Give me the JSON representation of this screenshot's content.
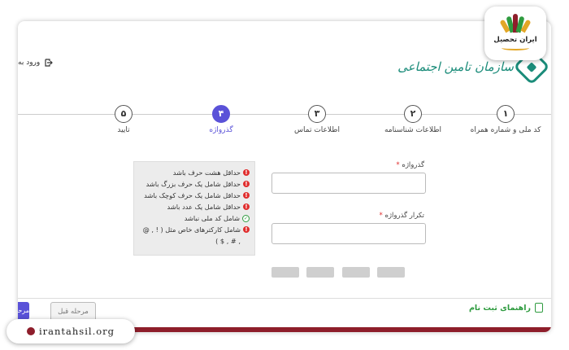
{
  "header": {
    "login_label": "ورود به",
    "logo_text": "سازمان تامین اجتماعی"
  },
  "steps": [
    {
      "number": "۱",
      "label": "کد ملی و شماره همراه"
    },
    {
      "number": "۲",
      "label": "اطلاعات شناسنامه"
    },
    {
      "number": "۳",
      "label": "اطلاعات تماس"
    },
    {
      "number": "۴",
      "label": "گذرواژه",
      "active": true
    },
    {
      "number": "۵",
      "label": "تایید"
    }
  ],
  "form": {
    "password_label": "گذرواژه",
    "password_required": "*",
    "password_value": "",
    "confirm_label": "تکرار گذرواژه",
    "confirm_required": "*",
    "confirm_value": ""
  },
  "rules": [
    {
      "text": "حداقل هشت حرف باشد",
      "status": "error"
    },
    {
      "text": "حداقل شامل یک حرف بزرگ باشد",
      "status": "error"
    },
    {
      "text": "حداقل شامل یک حرف کوچک باشد",
      "status": "error"
    },
    {
      "text": "حداقل شامل یک عدد باشد",
      "status": "error"
    },
    {
      "text": "شامل کد ملی نباشد",
      "status": "ok"
    },
    {
      "text": "شامل کارکترهای خاص مثل ( ! , @ , # , $ )",
      "status": "error"
    }
  ],
  "footer": {
    "guide_label": "راهنمای ثبت نام",
    "prev_label": "مرحله قبل",
    "next_label": "مرحله"
  },
  "watermark": {
    "badge_text": "ایران تحصیل",
    "site_url": "irantahsil.org"
  },
  "colors": {
    "accent": "#5a52d8",
    "logo": "#1b8c7a",
    "error": "#e02d2d",
    "ok": "#2e9b3f",
    "brand_bar": "#8e1e2b"
  }
}
